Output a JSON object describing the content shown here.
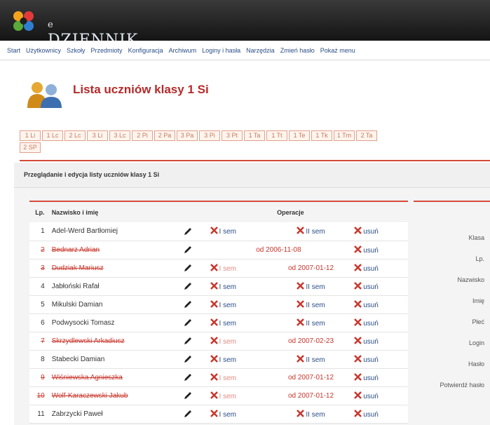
{
  "app": {
    "logo_prefix": "e",
    "logo_name": "DZIENNIK"
  },
  "menu": [
    "Start",
    "Użytkownicy",
    "Szkoły",
    "Przedmioty",
    "Konfiguracja",
    "Archiwum",
    "Loginy i hasła",
    "Narzędzia",
    "Zmień hasło",
    "Pokaż menu"
  ],
  "page": {
    "title": "Lista uczniów klasy 1 Si"
  },
  "class_tabs": [
    "1 Li",
    "1 Lc",
    "2 Lc",
    "3 Li",
    "3 Lc",
    "2 Pi",
    "2 Pa",
    "3 Pa",
    "3 Pi",
    "3 Pt",
    "1 Ta",
    "1 Tt",
    "1 Te",
    "1 Tk",
    "1 Tm",
    "2 Ta",
    "2 SP"
  ],
  "section": {
    "header": "Przeglądanie i edycja listy uczniów klasy 1 Si"
  },
  "table": {
    "col_lp": "Lp.",
    "col_name": "Nazwisko i imię",
    "col_operations": "Operacje",
    "rows": [
      {
        "lp": "1",
        "name": "Adel-Werd Bartłomiej",
        "removed": false,
        "sem1": "I sem",
        "sem2": "II sem",
        "delete": "usuń"
      },
      {
        "lp": "2",
        "name": "Bednarz Adrian",
        "removed": true,
        "span_date": "od 2006-11-08",
        "delete": "usuń"
      },
      {
        "lp": "3",
        "name": "Dudziak Mariusz",
        "removed": true,
        "sem1": "I sem",
        "sem2_date": "od 2007-01-12",
        "delete": "usuń"
      },
      {
        "lp": "4",
        "name": "Jabłoński Rafał",
        "removed": false,
        "sem1": "I sem",
        "sem2": "II sem",
        "delete": "usuń"
      },
      {
        "lp": "5",
        "name": "Mikulski Damian",
        "removed": false,
        "sem1": "I sem",
        "sem2": "II sem",
        "delete": "usuń"
      },
      {
        "lp": "6",
        "name": "Podwysocki Tomasz",
        "removed": false,
        "sem1": "I sem",
        "sem2": "II sem",
        "delete": "usuń"
      },
      {
        "lp": "7",
        "name": "Skrzydlewski Arkadiusz",
        "removed": true,
        "sem1": "I sem",
        "sem2_date": "od 2007-02-23",
        "delete": "usuń"
      },
      {
        "lp": "8",
        "name": "Stabecki Damian",
        "removed": false,
        "sem1": "I sem",
        "sem2": "II sem",
        "delete": "usuń"
      },
      {
        "lp": "9",
        "name": "Wiśniewska Agnieszka",
        "removed": true,
        "sem1": "I sem",
        "sem2_date": "od 2007-01-12",
        "delete": "usuń"
      },
      {
        "lp": "10",
        "name": "Wolf-Karaczewski Jakub",
        "removed": true,
        "sem1": "I sem",
        "sem2_date": "od 2007-01-12",
        "delete": "usuń"
      },
      {
        "lp": "11",
        "name": "Zabrzycki Paweł",
        "removed": false,
        "sem1": "I sem",
        "sem2": "II sem",
        "delete": "usuń"
      }
    ]
  },
  "form": {
    "labels": [
      "Klasa",
      "Lp.",
      "Nazwisko",
      "Imię",
      "Płeć",
      "Login",
      "Hasło",
      "Potwierdź hasło"
    ]
  },
  "colors": {
    "accent": "#d44a3a",
    "title": "#b52a2a",
    "link": "#2a4d86",
    "topbar": "#1e1e1e"
  },
  "icons": {
    "logo": "joomla-logo-icon",
    "page": "users-group-icon",
    "edit": "pencil-icon",
    "remove": "x-icon"
  }
}
